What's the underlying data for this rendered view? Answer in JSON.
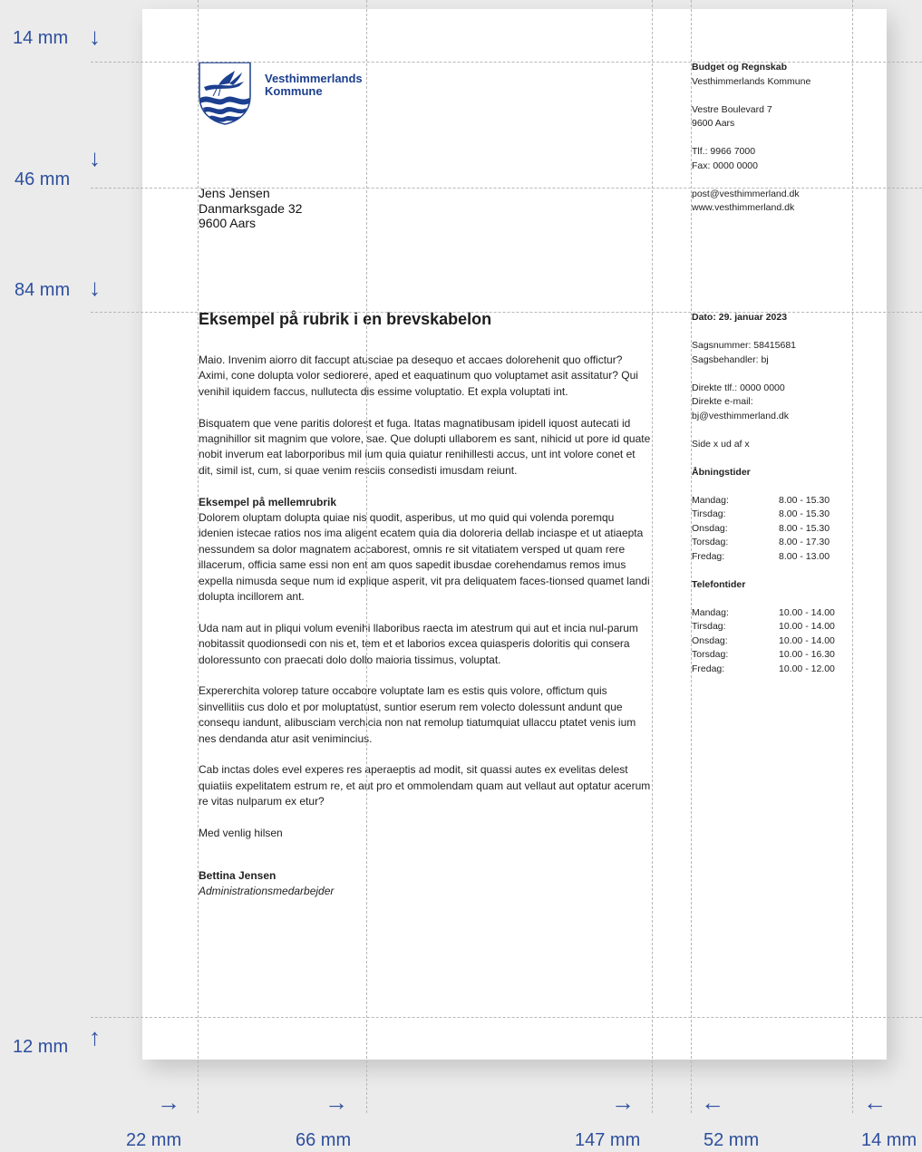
{
  "logo": {
    "line1": "Vesthimmerlands",
    "line2": "Kommune"
  },
  "recipient": {
    "name": "Jens Jensen",
    "street": "Danmarksgade 32",
    "city": "9600 Aars"
  },
  "sender": {
    "department": "Budget og Regnskab",
    "org": "Vesthimmerlands Kommune",
    "street": "Vestre Boulevard 7",
    "city": "9600 Aars",
    "phone": "Tlf.: 9966 7000",
    "fax": "Fax: 0000 0000",
    "email": "post@vesthimmerland.dk",
    "web": "www.vesthimmerland.dk"
  },
  "details": {
    "date": "Dato: 29. januar 2023",
    "case_number": "Sagsnummer: 58415681",
    "case_handler": "Sagsbehandler: bj",
    "direct_phone": "Direkte tlf.: 0000 0000",
    "direct_email_label": "Direkte e-mail:",
    "direct_email": "bj@vesthimmerland.dk",
    "page": "Side x ud af x"
  },
  "opening_hours": {
    "heading": "Åbningstider",
    "rows": [
      {
        "day": "Mandag:",
        "time": "8.00 - 15.30"
      },
      {
        "day": "Tirsdag:",
        "time": "8.00 - 15.30"
      },
      {
        "day": "Onsdag:",
        "time": "8.00 - 15.30"
      },
      {
        "day": "Torsdag:",
        "time": "8.00 - 17.30"
      },
      {
        "day": "Fredag:",
        "time": "8.00 - 13.00"
      }
    ]
  },
  "phone_hours": {
    "heading": "Telefontider",
    "rows": [
      {
        "day": "Mandag:",
        "time": "10.00 - 14.00"
      },
      {
        "day": "Tirsdag:",
        "time": "10.00 - 14.00"
      },
      {
        "day": "Onsdag:",
        "time": "10.00 - 14.00"
      },
      {
        "day": "Torsdag:",
        "time": "10.00 - 16.30"
      },
      {
        "day": "Fredag:",
        "time": "10.00 - 12.00"
      }
    ]
  },
  "letter": {
    "title": "Eksempel på rubrik i en brevskabelon",
    "para1": "Maio. Invenim aiorro dit faccupt atusciae pa desequo et accaes dolorehenit quo offictur? Aximi, cone dolupta volor sediorere, aped et eaquatinum quo voluptamet asit assitatur? Qui venihil iquidem faccus, nullutecta dis essime voluptatio. Et expla voluptati int.",
    "para2": "Bisquatem que vene paritis dolorest et fuga. Itatas magnatibusam ipidell iquost autecati id magnihillor sit magnim que volore, sae. Que dolupti ullaborem es sant, nihicid ut pore id quate nobit inverum eat laborporibus mil ium quia quiatur renihillesti accus, unt int volore conet et dit, simil ist, cum, si quae venim resciis consedisti imusdam reiunt.",
    "subheading": "Eksempel på mellemrubrik",
    "para3": "Dolorem oluptam dolupta quiae nis quodit, asperibus, ut mo quid qui volenda poremqu idenien istecae ratios nos ima aligent ecatem quia dia doloreria dellab inciaspe et ut atiaepta nessundem sa dolor magnatem accaborest, omnis re sit vitatiatem versped ut quam rere illacerum, officia same essi non ent am quos sapedit ibusdae corehendamus remos imus expella nimusda seque num id explique asperit, vit pra deliquatem faces-tionsed quamet landi dolupta incillorem ant.",
    "para4": "Uda nam aut in pliqui volum evenihi llaboribus raecta im atestrum qui aut et incia nul-parum nobitassit quodionsedi con nis et, tem et et laborios excea quiasperis doloritis qui consera doloressunto con praecati dolo dollo maioria tissimus, voluptat.",
    "para5": "Expererchita volorep tature occabore voluptate lam es estis quis volore, offictum quis sinvellitiis cus dolo et por moluptatust, suntior eserum rem volecto dolessunt andunt que consequ iandunt, alibusciam verchicia non nat remolup tiatumquiat ullaccu ptatet venis ium nes dendanda atur asit venimincius.",
    "para6": "Cab inctas doles evel experes res aperaeptis ad modit, sit quassi autes ex evelitas delest quiatiis expelitatem estrum re, et aut pro et ommolendam quam aut vellaut aut optatur acerum re vitas nulparum ex etur?",
    "closing": "Med venlig hilsen",
    "signer_name": "Bettina Jensen",
    "signer_title": "Administrationsmedarbejder"
  },
  "measures": {
    "top": "14 mm",
    "logo_bottom": "46 mm",
    "content_top": "84 mm",
    "bottom": "12 mm",
    "left": "22 mm",
    "col2": "66 mm",
    "col3": "147 mm",
    "sidebar_width": "52 mm",
    "right": "14 mm"
  },
  "colors": {
    "accent": "#2d4f9e",
    "logo_blue": "#1c3f8f"
  }
}
